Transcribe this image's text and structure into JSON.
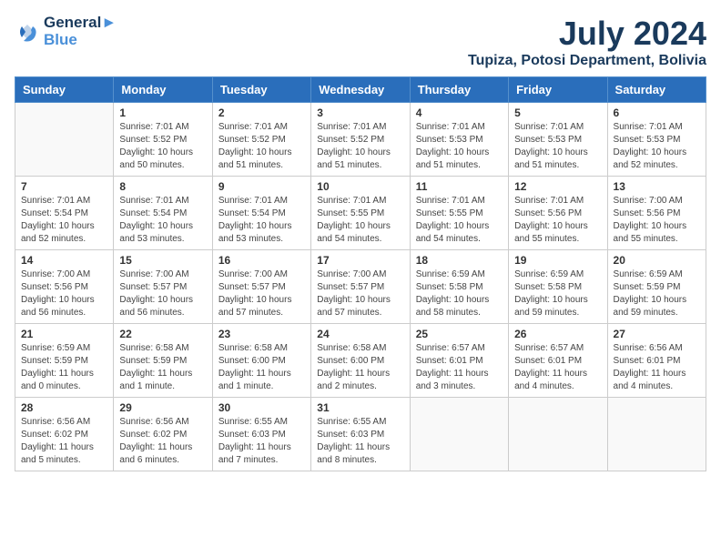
{
  "header": {
    "logo_line1": "General",
    "logo_line2": "Blue",
    "title": "July 2024",
    "subtitle": "Tupiza, Potosi Department, Bolivia"
  },
  "weekdays": [
    "Sunday",
    "Monday",
    "Tuesday",
    "Wednesday",
    "Thursday",
    "Friday",
    "Saturday"
  ],
  "weeks": [
    [
      {
        "day": "",
        "info": ""
      },
      {
        "day": "1",
        "info": "Sunrise: 7:01 AM\nSunset: 5:52 PM\nDaylight: 10 hours\nand 50 minutes."
      },
      {
        "day": "2",
        "info": "Sunrise: 7:01 AM\nSunset: 5:52 PM\nDaylight: 10 hours\nand 51 minutes."
      },
      {
        "day": "3",
        "info": "Sunrise: 7:01 AM\nSunset: 5:52 PM\nDaylight: 10 hours\nand 51 minutes."
      },
      {
        "day": "4",
        "info": "Sunrise: 7:01 AM\nSunset: 5:53 PM\nDaylight: 10 hours\nand 51 minutes."
      },
      {
        "day": "5",
        "info": "Sunrise: 7:01 AM\nSunset: 5:53 PM\nDaylight: 10 hours\nand 51 minutes."
      },
      {
        "day": "6",
        "info": "Sunrise: 7:01 AM\nSunset: 5:53 PM\nDaylight: 10 hours\nand 52 minutes."
      }
    ],
    [
      {
        "day": "7",
        "info": "Sunrise: 7:01 AM\nSunset: 5:54 PM\nDaylight: 10 hours\nand 52 minutes."
      },
      {
        "day": "8",
        "info": "Sunrise: 7:01 AM\nSunset: 5:54 PM\nDaylight: 10 hours\nand 53 minutes."
      },
      {
        "day": "9",
        "info": "Sunrise: 7:01 AM\nSunset: 5:54 PM\nDaylight: 10 hours\nand 53 minutes."
      },
      {
        "day": "10",
        "info": "Sunrise: 7:01 AM\nSunset: 5:55 PM\nDaylight: 10 hours\nand 54 minutes."
      },
      {
        "day": "11",
        "info": "Sunrise: 7:01 AM\nSunset: 5:55 PM\nDaylight: 10 hours\nand 54 minutes."
      },
      {
        "day": "12",
        "info": "Sunrise: 7:01 AM\nSunset: 5:56 PM\nDaylight: 10 hours\nand 55 minutes."
      },
      {
        "day": "13",
        "info": "Sunrise: 7:00 AM\nSunset: 5:56 PM\nDaylight: 10 hours\nand 55 minutes."
      }
    ],
    [
      {
        "day": "14",
        "info": "Sunrise: 7:00 AM\nSunset: 5:56 PM\nDaylight: 10 hours\nand 56 minutes."
      },
      {
        "day": "15",
        "info": "Sunrise: 7:00 AM\nSunset: 5:57 PM\nDaylight: 10 hours\nand 56 minutes."
      },
      {
        "day": "16",
        "info": "Sunrise: 7:00 AM\nSunset: 5:57 PM\nDaylight: 10 hours\nand 57 minutes."
      },
      {
        "day": "17",
        "info": "Sunrise: 7:00 AM\nSunset: 5:57 PM\nDaylight: 10 hours\nand 57 minutes."
      },
      {
        "day": "18",
        "info": "Sunrise: 6:59 AM\nSunset: 5:58 PM\nDaylight: 10 hours\nand 58 minutes."
      },
      {
        "day": "19",
        "info": "Sunrise: 6:59 AM\nSunset: 5:58 PM\nDaylight: 10 hours\nand 59 minutes."
      },
      {
        "day": "20",
        "info": "Sunrise: 6:59 AM\nSunset: 5:59 PM\nDaylight: 10 hours\nand 59 minutes."
      }
    ],
    [
      {
        "day": "21",
        "info": "Sunrise: 6:59 AM\nSunset: 5:59 PM\nDaylight: 11 hours\nand 0 minutes."
      },
      {
        "day": "22",
        "info": "Sunrise: 6:58 AM\nSunset: 5:59 PM\nDaylight: 11 hours\nand 1 minute."
      },
      {
        "day": "23",
        "info": "Sunrise: 6:58 AM\nSunset: 6:00 PM\nDaylight: 11 hours\nand 1 minute."
      },
      {
        "day": "24",
        "info": "Sunrise: 6:58 AM\nSunset: 6:00 PM\nDaylight: 11 hours\nand 2 minutes."
      },
      {
        "day": "25",
        "info": "Sunrise: 6:57 AM\nSunset: 6:01 PM\nDaylight: 11 hours\nand 3 minutes."
      },
      {
        "day": "26",
        "info": "Sunrise: 6:57 AM\nSunset: 6:01 PM\nDaylight: 11 hours\nand 4 minutes."
      },
      {
        "day": "27",
        "info": "Sunrise: 6:56 AM\nSunset: 6:01 PM\nDaylight: 11 hours\nand 4 minutes."
      }
    ],
    [
      {
        "day": "28",
        "info": "Sunrise: 6:56 AM\nSunset: 6:02 PM\nDaylight: 11 hours\nand 5 minutes."
      },
      {
        "day": "29",
        "info": "Sunrise: 6:56 AM\nSunset: 6:02 PM\nDaylight: 11 hours\nand 6 minutes."
      },
      {
        "day": "30",
        "info": "Sunrise: 6:55 AM\nSunset: 6:03 PM\nDaylight: 11 hours\nand 7 minutes."
      },
      {
        "day": "31",
        "info": "Sunrise: 6:55 AM\nSunset: 6:03 PM\nDaylight: 11 hours\nand 8 minutes."
      },
      {
        "day": "",
        "info": ""
      },
      {
        "day": "",
        "info": ""
      },
      {
        "day": "",
        "info": ""
      }
    ]
  ]
}
